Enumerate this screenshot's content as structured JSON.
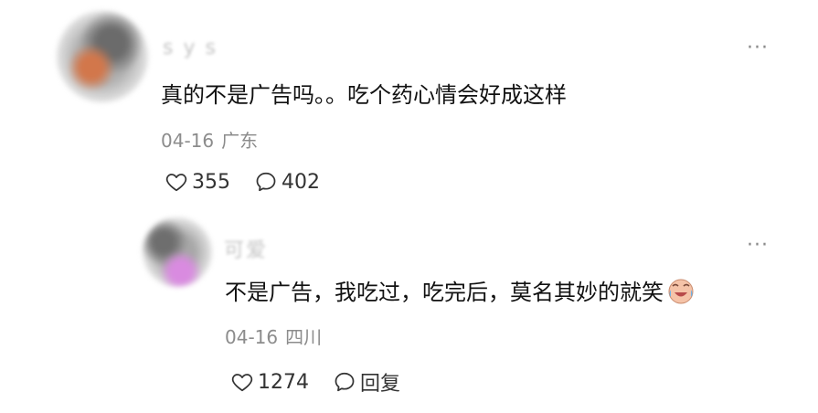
{
  "comments": [
    {
      "username": "s  y  s",
      "text": "真的不是广告吗。。吃个药心情会好成这样",
      "date": "04-16",
      "location": "广东",
      "likes": "355",
      "replies": "402",
      "more": "···"
    },
    {
      "username": "可爱",
      "text": "不是广告，我吃过，吃完后，莫名其妙的就笑",
      "emoji": "laughing-with-tears-emoji",
      "date": "04-16",
      "location": "四川",
      "likes": "1274",
      "reply_label": "回复",
      "more": "···"
    }
  ],
  "icons": {
    "like": "heart-outline-icon",
    "reply": "speech-bubble-outline-icon",
    "more": "ellipsis-icon"
  },
  "colors": {
    "text": "#111111",
    "meta": "#8c8c8c",
    "icon": "#333333",
    "background": "#ffffff"
  }
}
